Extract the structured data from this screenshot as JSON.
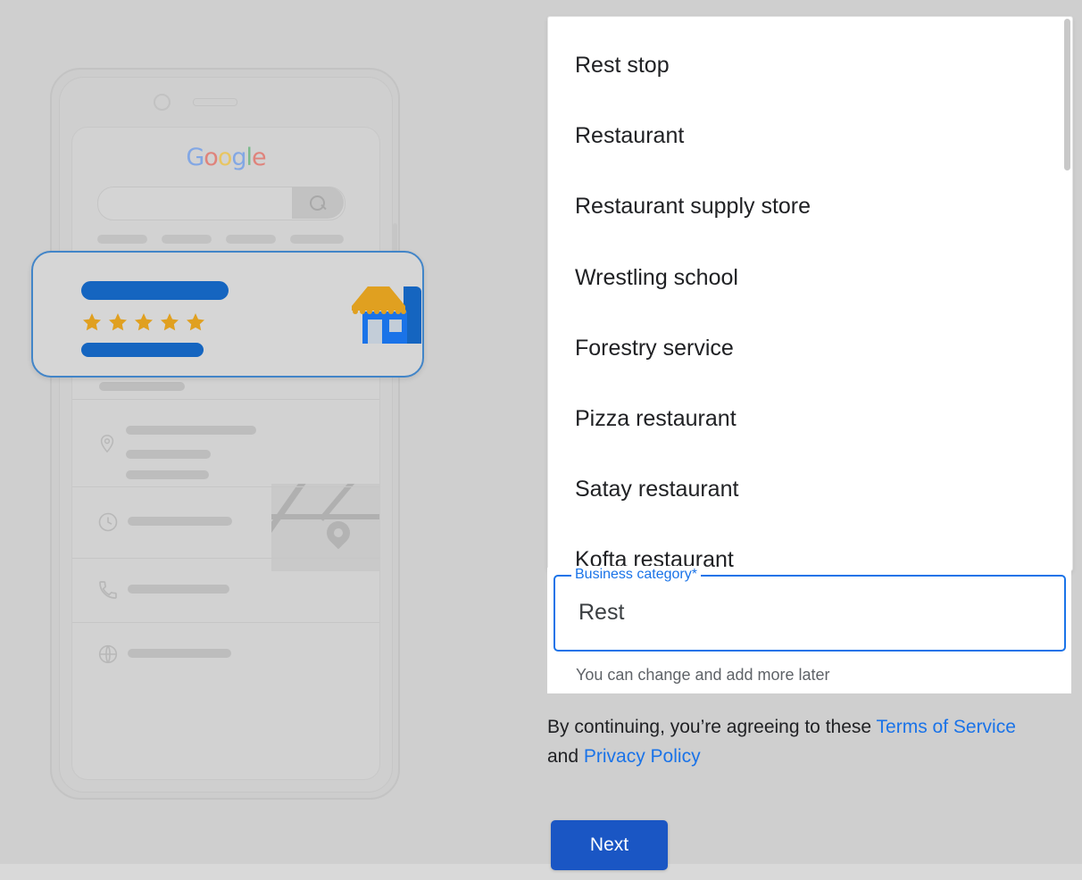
{
  "background_color": "#cfcfcf",
  "accent_color": "#1a73e8",
  "illustration": {
    "name": "google-business-profile-phone-illustration",
    "google_logo": {
      "g1": "G",
      "o1": "o",
      "o2": "o",
      "g2": "g",
      "l": "l",
      "e": "e"
    },
    "search_placeholder": "",
    "highlight_card": {
      "name": "business-listing-card",
      "rating_stars": 5,
      "star_glyph": "★"
    },
    "store_icon_name": "storefront-icon",
    "action_icons": [
      "call-icon",
      "directions-icon",
      "save-icon",
      "share-icon"
    ],
    "detail_icons": [
      "location-pin-icon",
      "clock-icon",
      "phone-icon",
      "globe-icon"
    ],
    "chevron": "›"
  },
  "dropdown": {
    "name": "business-category-suggestions",
    "items": [
      "Rest stop",
      "Restaurant",
      "Restaurant supply store",
      "Wrestling school",
      "Forestry service",
      "Pizza restaurant",
      "Satay restaurant",
      "Kofta restaurant"
    ]
  },
  "field": {
    "label": "Business category*",
    "value": "Rest",
    "placeholder": "Business category",
    "helper_text": "You can change and add more later"
  },
  "terms": {
    "prefix": "By continuing, you’re agreeing to these ",
    "link1": "Terms of Service",
    "middle": " and ",
    "link2": "Privacy Policy"
  },
  "actions": {
    "next_label": "Next"
  }
}
